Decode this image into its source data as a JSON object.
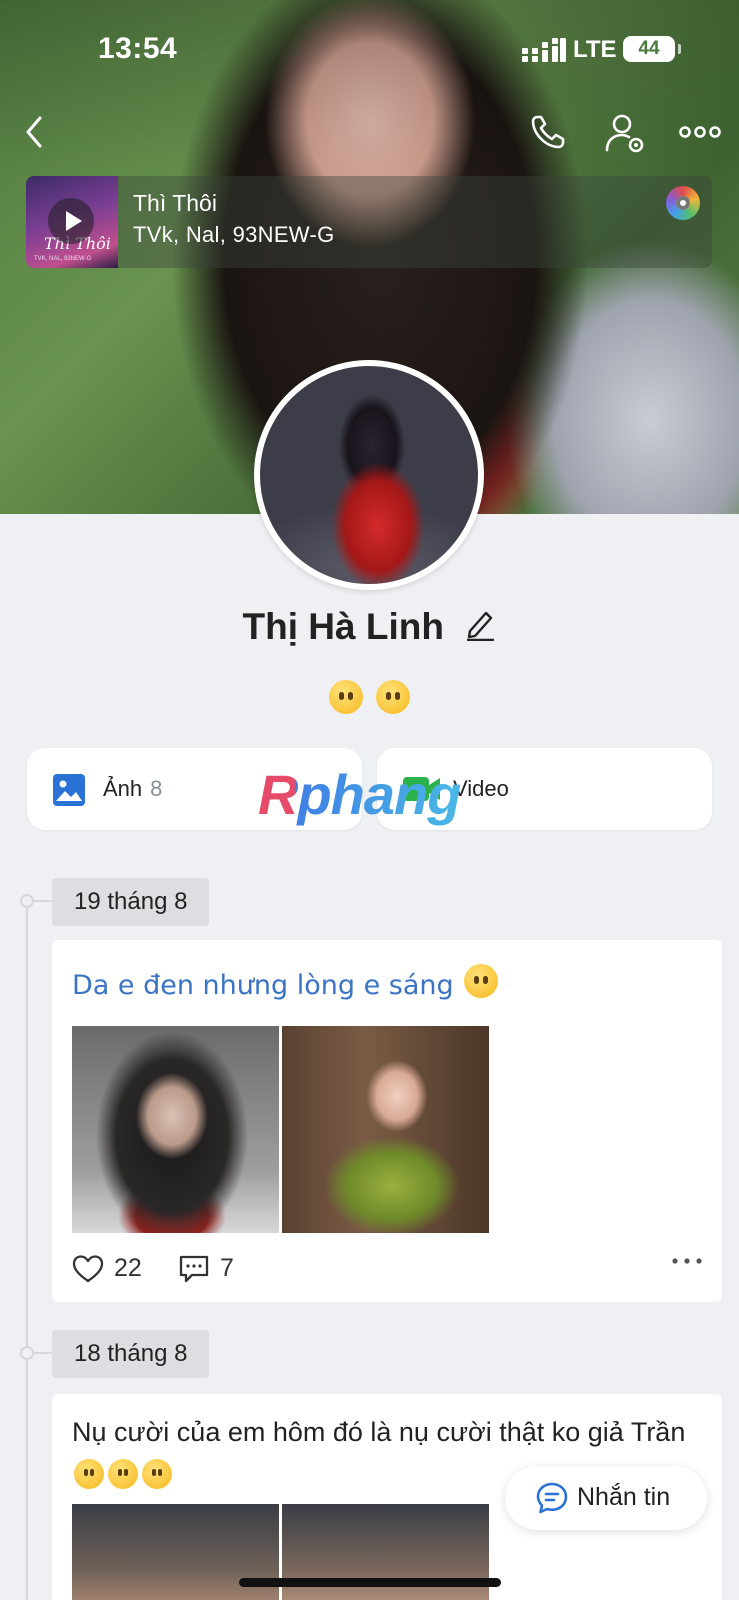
{
  "status_bar": {
    "time": "13:54",
    "network": "LTE",
    "battery": "44"
  },
  "music": {
    "title": "Thì Thôi",
    "artist": "TVk, Nal, 93NEW-G",
    "cover_title": "Thì Thôi",
    "cover_subtitle": "TVK, NAL, 93NEW-G"
  },
  "profile": {
    "name": "Thị Hà Linh"
  },
  "tabs": {
    "photos_label": "Ảnh",
    "photos_count": "8",
    "video_label": "Video"
  },
  "watermark": "Rphang",
  "posts": [
    {
      "date": "19 tháng 8",
      "text": "Da e đen nhưng lòng e sáng",
      "likes": "22",
      "comments": "7"
    },
    {
      "date": "18 tháng 8",
      "text": "Nụ cười của em hôm đó là nụ cười thật ko giả Trần"
    }
  ],
  "message_button": "Nhắn tin",
  "colors": {
    "accent": "#3b74c4",
    "background": "#eef0f4"
  },
  "icons": [
    "back-icon",
    "phone-icon",
    "user-settings-icon",
    "more-icon",
    "music-disc-icon",
    "edit-icon",
    "photo-icon",
    "video-icon",
    "heart-icon",
    "comment-icon",
    "chat-icon"
  ]
}
